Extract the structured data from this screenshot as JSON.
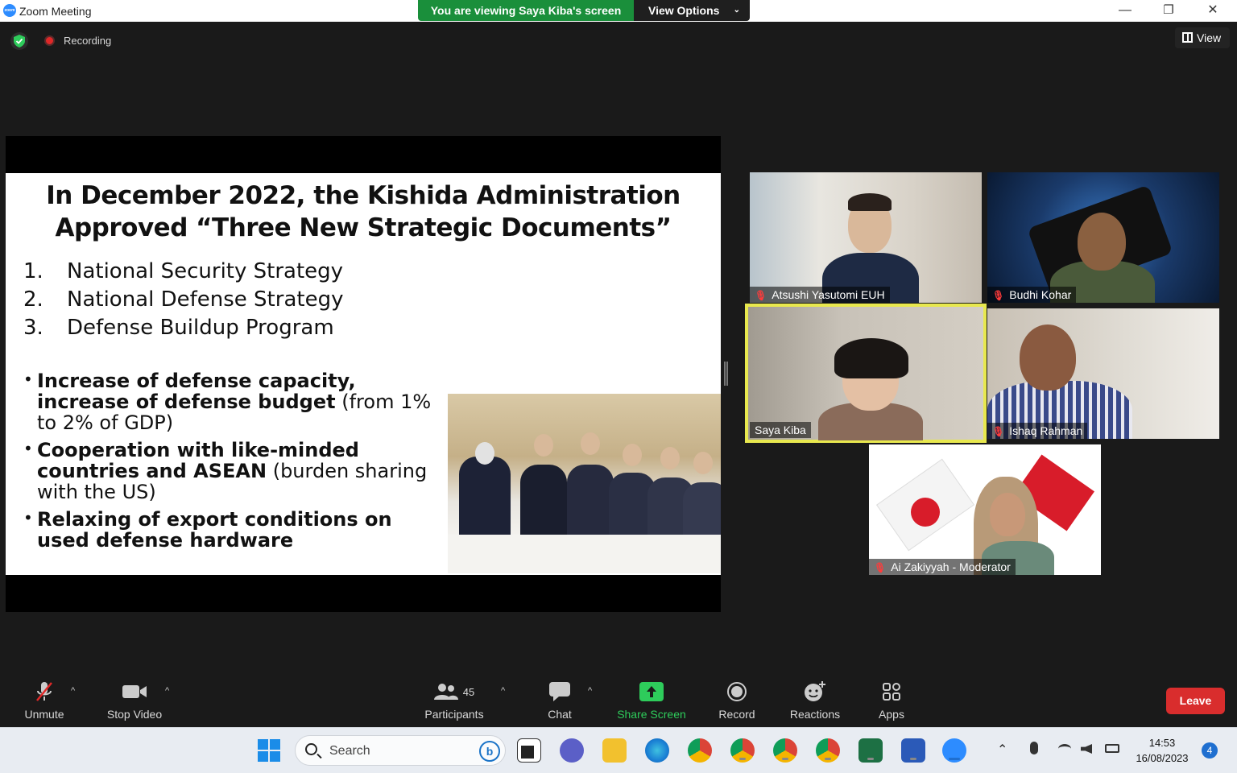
{
  "window": {
    "title": "Zoom Meeting",
    "minimize": "—",
    "restore": "❐",
    "close": "✕"
  },
  "banner": {
    "viewing": "You are viewing Saya Kiba's screen",
    "view_options": "View Options",
    "chevron": "⌄"
  },
  "status": {
    "recording": "Recording",
    "view": "View"
  },
  "slide": {
    "title_line1": "In December 2022, the Kishida Administration",
    "title_line2": "Approved “Three New Strategic Documents”",
    "list": [
      {
        "num": "1.",
        "text": "National Security Strategy"
      },
      {
        "num": "2.",
        "text": "National Defense Strategy"
      },
      {
        "num": "3.",
        "text": "Defense Buildup Program"
      }
    ],
    "bullets": [
      {
        "bold": "Increase of defense capacity, increase of defense budget",
        "rest": " (from 1% to 2% of GDP)"
      },
      {
        "bold": "Cooperation with like-minded countries and ASEAN",
        "rest": " (burden sharing with the US)"
      },
      {
        "bold": "Relaxing of export conditions on used defense hardware",
        "rest": ""
      }
    ]
  },
  "participants_tiles": [
    {
      "name": "Atsushi Yasutomi EUH",
      "muted": true
    },
    {
      "name": "Budhi Kohar",
      "muted": true
    },
    {
      "name": "Saya Kiba",
      "muted": false
    },
    {
      "name": "Ishaq Rahman",
      "muted": true
    },
    {
      "name": "Ai Zakiyyah - Moderator",
      "muted": true
    }
  ],
  "toolbar": {
    "unmute": "Unmute",
    "stop_video": "Stop Video",
    "participants": "Participants",
    "participant_count": "45",
    "chat": "Chat",
    "share_screen": "Share Screen",
    "record": "Record",
    "reactions": "Reactions",
    "apps": "Apps",
    "leave": "Leave",
    "caret": "^"
  },
  "taskbar": {
    "search": "Search",
    "bing": "b",
    "time": "14:53",
    "date": "16/08/2023",
    "notifications": "4",
    "chevron": "⌃"
  },
  "colors": {
    "accent_green": "#1a8f3b",
    "leave_red": "#d92d2d",
    "active_speaker": "#e8e84e"
  }
}
